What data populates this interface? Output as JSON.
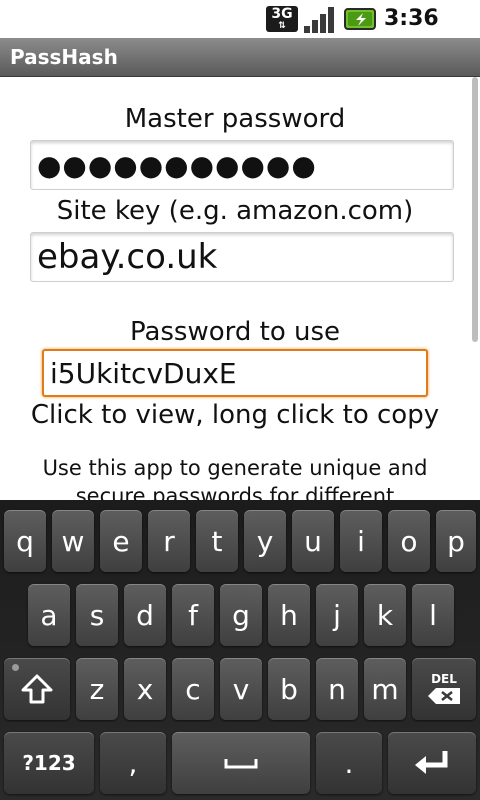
{
  "status_bar": {
    "network_label": "3G",
    "time": "3:36 PM",
    "icons": [
      "3g-data-icon",
      "signal-strength-icon",
      "battery-charging-icon"
    ]
  },
  "app": {
    "title": "PassHash"
  },
  "form": {
    "master_label": "Master password",
    "master_value": "●●●●●●●●●●●",
    "site_label": "Site key (e.g. amazon.com)",
    "site_value": "ebay.co.uk",
    "result_label": "Password to use",
    "result_value": "i5UkitcvDuxE",
    "result_hint": "Click to view, long click to copy",
    "about_line1": "Use this app to generate unique and",
    "about_line2": "secure passwords for different"
  },
  "keyboard": {
    "row1": [
      "q",
      "w",
      "e",
      "r",
      "t",
      "y",
      "u",
      "i",
      "o",
      "p"
    ],
    "row2": [
      "a",
      "s",
      "d",
      "f",
      "g",
      "h",
      "j",
      "k",
      "l"
    ],
    "row3": [
      "z",
      "x",
      "c",
      "v",
      "b",
      "n",
      "m"
    ],
    "symbols_label": "?123",
    "comma_label": ",",
    "period_label": ".",
    "delete_label": "DEL",
    "accent_color": "#e07b1a"
  }
}
